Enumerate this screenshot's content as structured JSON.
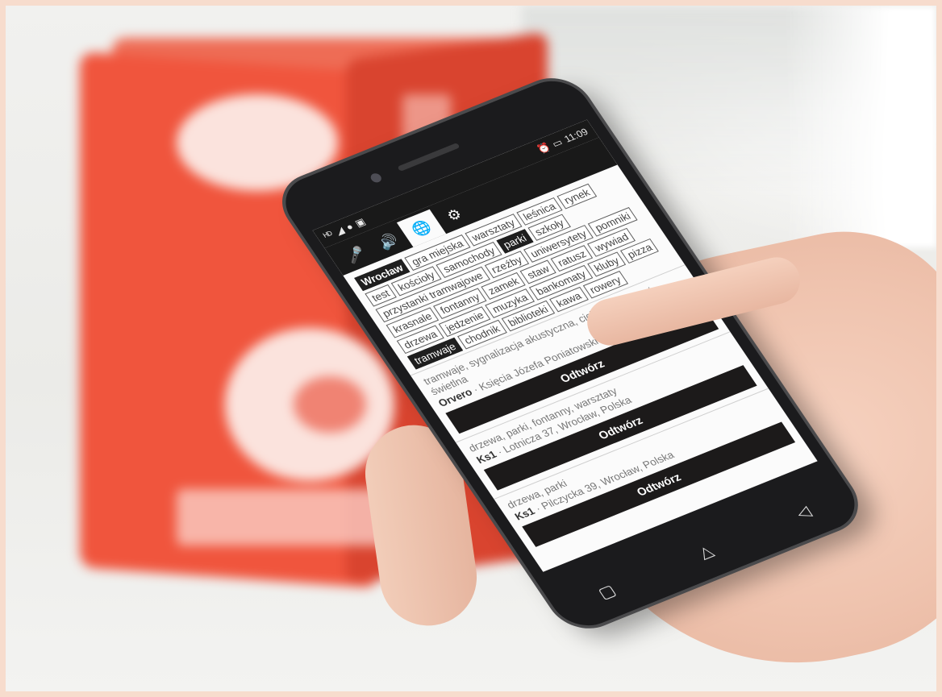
{
  "status": {
    "left_icons": [
      "volte-icon",
      "signal-icon",
      "messenger-icon",
      "image-icon"
    ],
    "right_icons": [
      "alarm-icon",
      "battery-icon"
    ],
    "time": "11:09"
  },
  "tabs": [
    {
      "name": "microphone-icon",
      "glyph": "🎤"
    },
    {
      "name": "speaker-icon",
      "glyph": "🔊"
    },
    {
      "name": "globe-icon",
      "glyph": "🌐",
      "active": true
    },
    {
      "name": "gear-icon",
      "glyph": "⚙"
    }
  ],
  "location_tag": "Wrocław",
  "tags": [
    {
      "label": "gra miejska"
    },
    {
      "label": "warsztaty"
    },
    {
      "label": "leśnica"
    },
    {
      "label": "rynek"
    },
    {
      "label": "test"
    },
    {
      "label": "kościoły"
    },
    {
      "label": "samochody"
    },
    {
      "label": "parki",
      "selected": true
    },
    {
      "label": "szkoły"
    },
    {
      "label": "przystanki tramwajowe"
    },
    {
      "label": "rzeźby"
    },
    {
      "label": "uniwersytety"
    },
    {
      "label": "pomniki"
    },
    {
      "label": "krasnale"
    },
    {
      "label": "fontanny"
    },
    {
      "label": "zamek"
    },
    {
      "label": "staw"
    },
    {
      "label": "ratusz"
    },
    {
      "label": "wywiad"
    },
    {
      "label": "drzewa"
    },
    {
      "label": "jedzenie"
    },
    {
      "label": "muzyka"
    },
    {
      "label": "bankomaty"
    },
    {
      "label": "kluby"
    },
    {
      "label": "pizza"
    },
    {
      "label": "tramwaje",
      "selected": true
    },
    {
      "label": "chodnik"
    },
    {
      "label": "biblioteki"
    },
    {
      "label": "kawa"
    },
    {
      "label": "rowery"
    }
  ],
  "results": [
    {
      "tags": "tramwaje, sygnalizacja akustyczna, cicha sygnalizacja świetlna",
      "author": "Orvero",
      "address": "Księcia Józefa Poniatowskiego 1, Wrocław, Polska",
      "button": "Odtwórz"
    },
    {
      "tags": "drzewa, parki, fontanny, warsztaty",
      "author": "Ks1",
      "address": "Lotnicza 37, Wrocław, Polska",
      "button": "Odtwórz"
    },
    {
      "tags": "drzewa, parki",
      "author": "Ks1",
      "address": "Pilczycka 39, Wrocław, Polska",
      "button": "Odtwórz"
    }
  ],
  "navbar": [
    {
      "name": "recent-apps-icon",
      "glyph": "▢"
    },
    {
      "name": "home-icon",
      "glyph": "△"
    },
    {
      "name": "back-icon",
      "glyph": "◁"
    }
  ]
}
